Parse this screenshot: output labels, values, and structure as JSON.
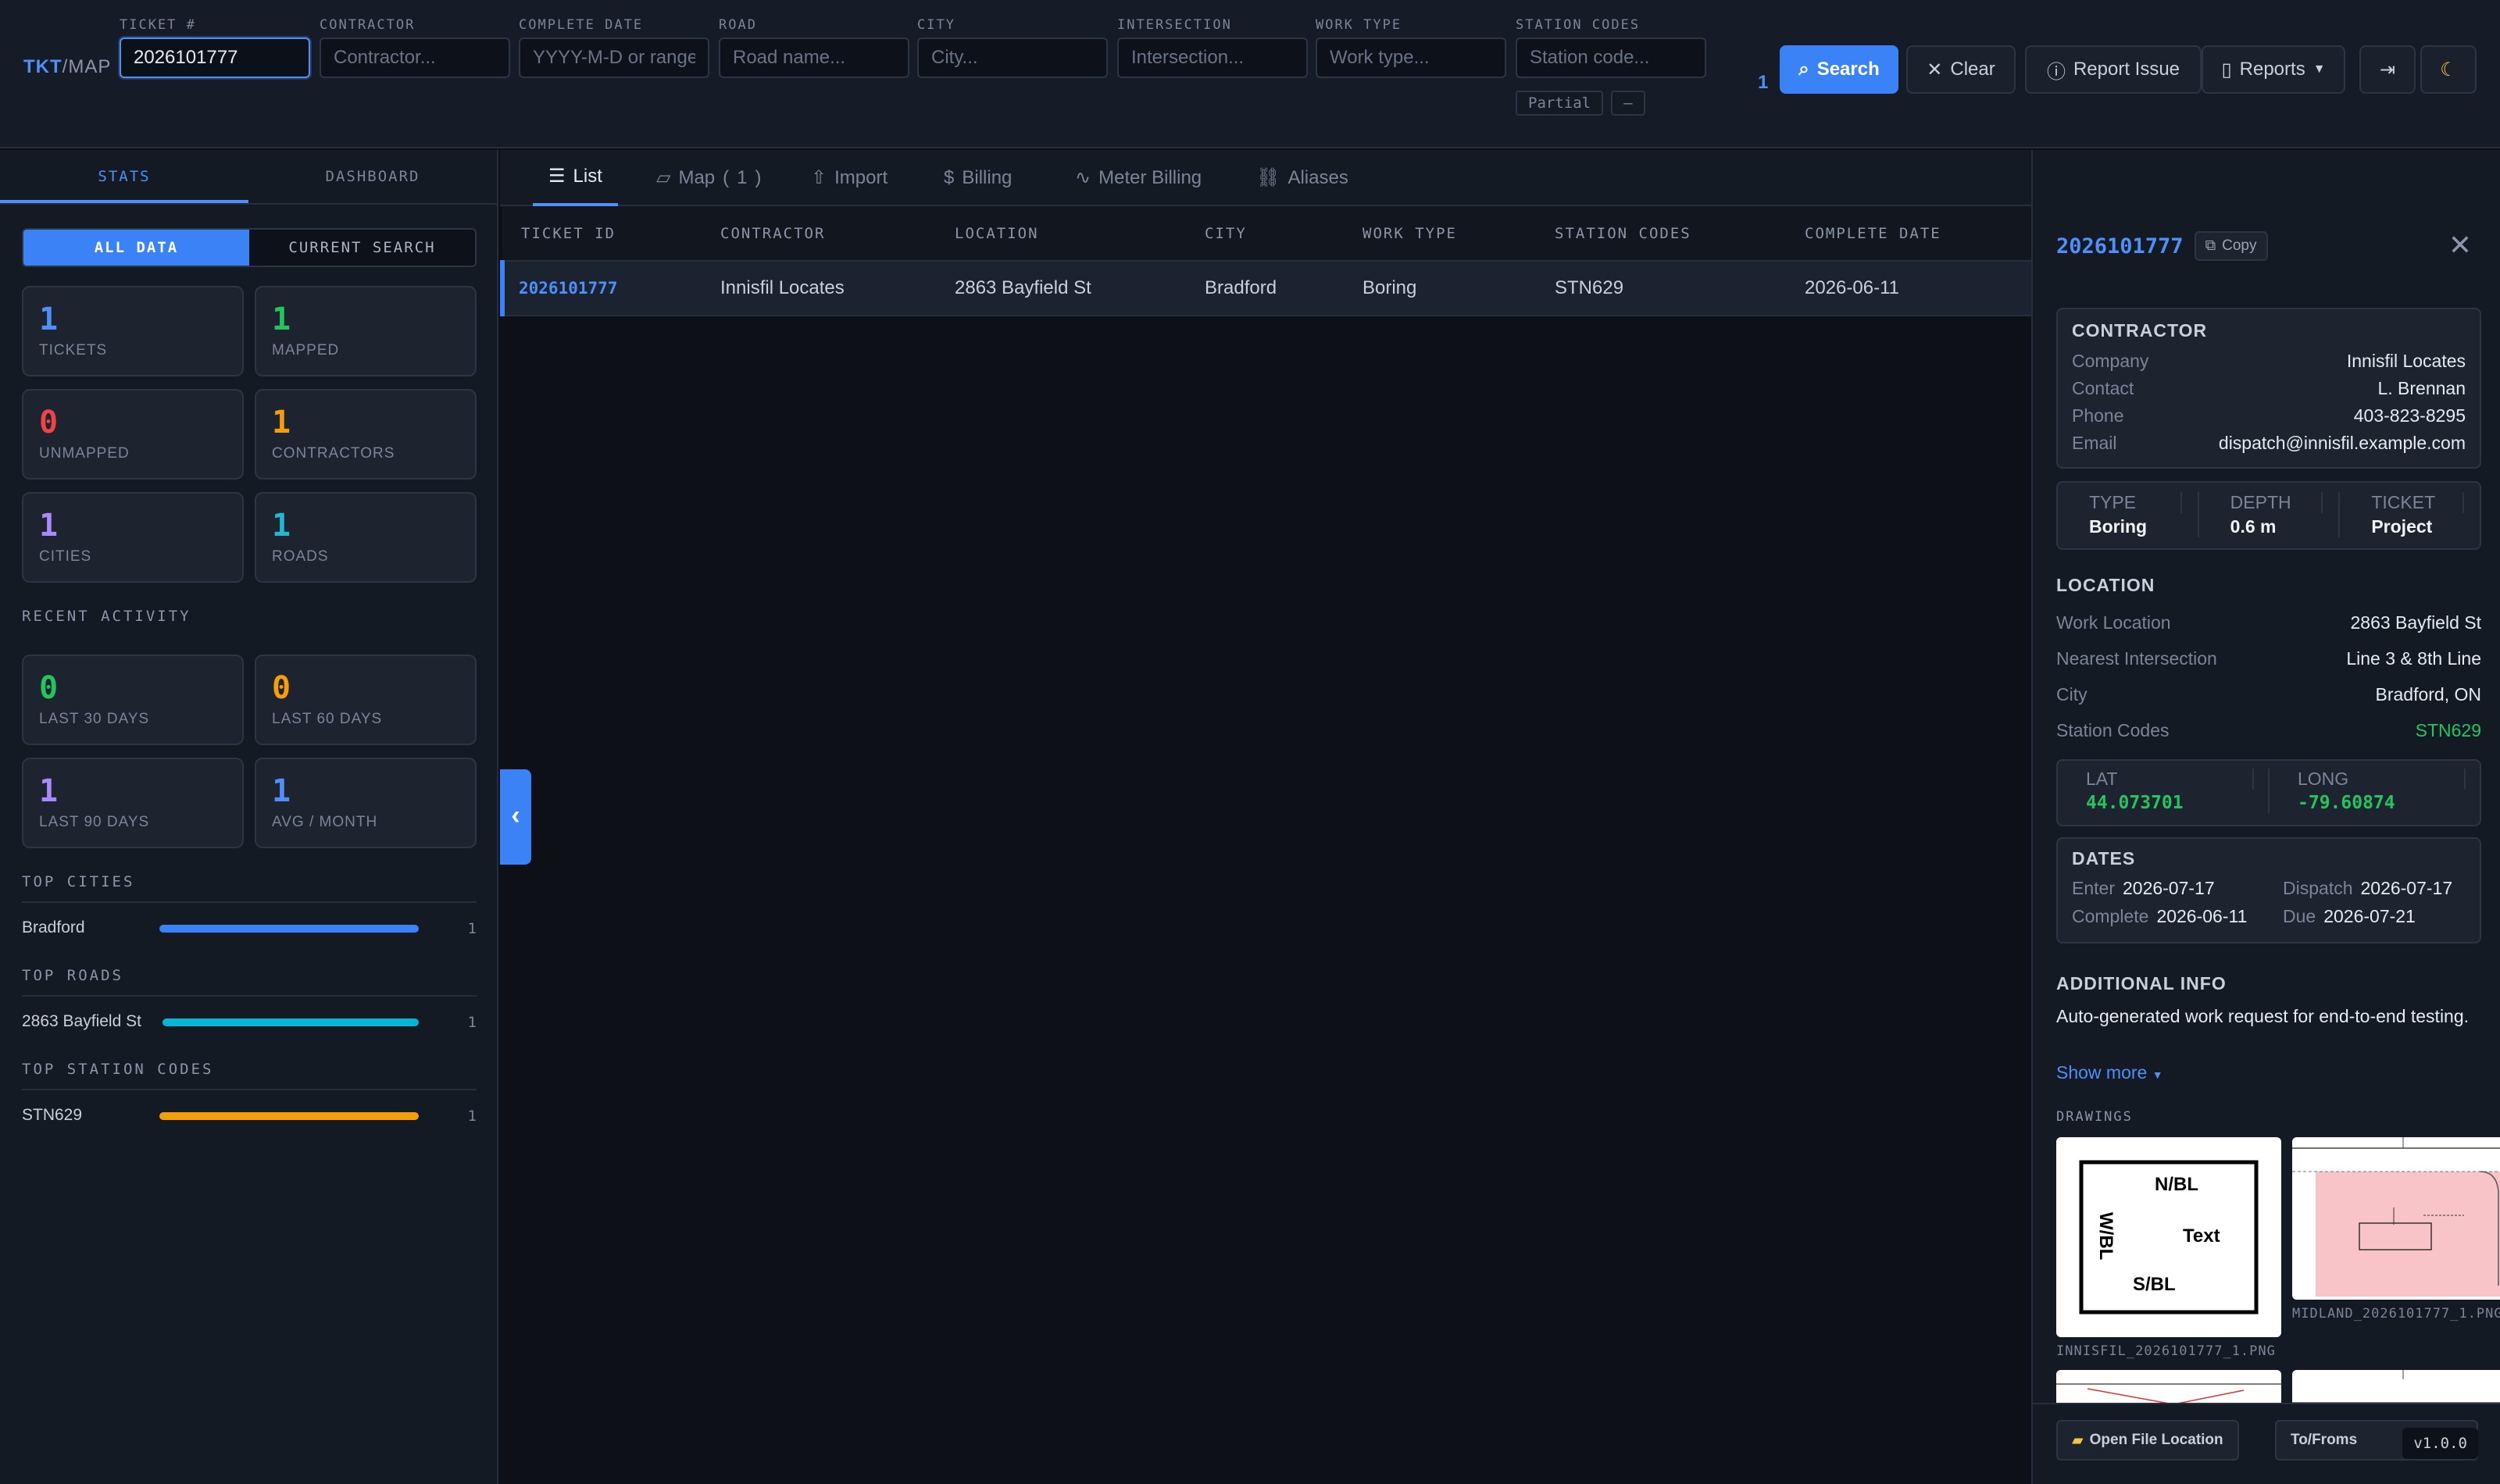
{
  "app": {
    "logo_primary": "TKT",
    "logo_sep": "/",
    "logo_secondary": "MAP"
  },
  "search": {
    "fields": [
      {
        "label": "TICKET #",
        "value": "2026101777",
        "placeholder": ""
      },
      {
        "label": "CONTRACTOR",
        "value": "",
        "placeholder": "Contractor..."
      },
      {
        "label": "COMPLETE DATE",
        "value": "",
        "placeholder": "YYYY-M-D or range"
      },
      {
        "label": "ROAD",
        "value": "",
        "placeholder": "Road name..."
      },
      {
        "label": "CITY",
        "value": "",
        "placeholder": "City..."
      },
      {
        "label": "INTERSECTION",
        "value": "",
        "placeholder": "Intersection..."
      },
      {
        "label": "WORK TYPE",
        "value": "",
        "placeholder": "Work type..."
      },
      {
        "label": "STATION CODES",
        "value": "",
        "placeholder": "Station code..."
      }
    ],
    "station_partial": "Partial",
    "station_dash": "–",
    "result_count": "1",
    "search_label": "Search",
    "clear_label": "Clear",
    "report_issue_label": "Report Issue",
    "reports_label": "Reports"
  },
  "left": {
    "tabs": [
      "STATS",
      "DASHBOARD"
    ],
    "active_tab": "STATS",
    "scope": [
      "ALL DATA",
      "CURRENT SEARCH"
    ],
    "stats": [
      {
        "value": "1",
        "label": "TICKETS",
        "color": "#4f8ff7"
      },
      {
        "value": "1",
        "label": "MAPPED",
        "color": "#22c55e"
      },
      {
        "value": "0",
        "label": "UNMAPPED",
        "color": "#ef4444"
      },
      {
        "value": "1",
        "label": "CONTRACTORS",
        "color": "#f59e0b"
      },
      {
        "value": "1",
        "label": "CITIES",
        "color": "#a78bfa"
      },
      {
        "value": "1",
        "label": "ROADS",
        "color": "#22b8cf"
      }
    ],
    "recent_title": "RECENT ACTIVITY",
    "recent": [
      {
        "value": "0",
        "label": "LAST 30 DAYS",
        "color": "#22c55e"
      },
      {
        "value": "0",
        "label": "LAST 60 DAYS",
        "color": "#f59e0b"
      },
      {
        "value": "1",
        "label": "LAST 90 DAYS",
        "color": "#a78bfa"
      },
      {
        "value": "1",
        "label": "AVG / MONTH",
        "color": "#4f8ff7"
      }
    ],
    "top_cities_title": "TOP CITIES",
    "top_cities": [
      {
        "name": "Bradford",
        "count": "1",
        "fraction": 1.0,
        "color": "#3b82f6"
      }
    ],
    "top_roads_title": "TOP ROADS",
    "top_roads": [
      {
        "name": "2863 Bayfield St",
        "count": "1",
        "fraction": 1.0,
        "color": "#06b6d4"
      }
    ],
    "top_station_title": "TOP STATION CODES",
    "top_station": [
      {
        "name": "STN629",
        "count": "1",
        "fraction": 1.0,
        "color": "#f59e0b"
      }
    ]
  },
  "center": {
    "tabs": [
      {
        "label": "List",
        "icon": "list-icon"
      },
      {
        "label": "Map",
        "count": "1",
        "icon": "map-icon"
      },
      {
        "label": "Import",
        "icon": "upload-icon"
      },
      {
        "label": "Billing",
        "icon": "dollar-icon"
      },
      {
        "label": "Meter Billing",
        "icon": "activity-icon"
      },
      {
        "label": "Aliases",
        "icon": "link-icon"
      }
    ],
    "columns": [
      "TICKET ID",
      "CONTRACTOR",
      "LOCATION",
      "CITY",
      "WORK TYPE",
      "STATION CODES",
      "COMPLETE DATE"
    ],
    "rows": [
      [
        "2026101777",
        "Innisfil Locates",
        "2863 Bayfield St",
        "Bradford",
        "Boring",
        "STN629",
        "2026-06-11"
      ]
    ]
  },
  "detail": {
    "ticket_id": "2026101777",
    "copy_label": "Copy",
    "contractor_title": "CONTRACTOR",
    "contractor": [
      {
        "k": "Company",
        "v": "Innisfil Locates"
      },
      {
        "k": "Contact",
        "v": "L. Brennan"
      },
      {
        "k": "Phone",
        "v": "403-823-8295"
      },
      {
        "k": "Email",
        "v": "dispatch@innisfil.example.com"
      }
    ],
    "meta": [
      {
        "k": "TYPE",
        "v": "Boring"
      },
      {
        "k": "DEPTH",
        "v": "0.6 m"
      },
      {
        "k": "TICKET",
        "v": "Project"
      }
    ],
    "location_title": "LOCATION",
    "location": [
      {
        "k": "Work Location",
        "v": "2863 Bayfield St"
      },
      {
        "k": "Nearest Intersection",
        "v": "Line 3 & 8th Line"
      },
      {
        "k": "City",
        "v": "Bradford, ON"
      },
      {
        "k": "Station Codes",
        "v": "STN629"
      }
    ],
    "lat_label": "LAT",
    "lat": "44.073701",
    "long_label": "LONG",
    "long": "-79.60874",
    "dates_title": "DATES",
    "dates": {
      "enter_label": "Enter",
      "enter": "2026-07-17",
      "dispatch_label": "Dispatch",
      "dispatch": "2026-07-17",
      "complete_label": "Complete",
      "complete": "2026-06-11",
      "due_label": "Due",
      "due": "2026-07-21"
    },
    "additional_title": "ADDITIONAL INFO",
    "additional_text": "Auto-generated work request for end-to-end testing.",
    "show_more": "Show more",
    "drawings_title": "DRAWINGS",
    "drawings": [
      {
        "caption": "INNISFIL_2026101777_1.PNG",
        "labels": {
          "north": "N/BL",
          "west": "W/BL",
          "south": "S/BL",
          "center": "Text"
        }
      },
      {
        "caption": "MIDLAND_2026101777_1.PNG"
      }
    ],
    "open_file_label": "Open File Location",
    "tofroms_label": "To/Froms",
    "version": "v1.0.0"
  }
}
